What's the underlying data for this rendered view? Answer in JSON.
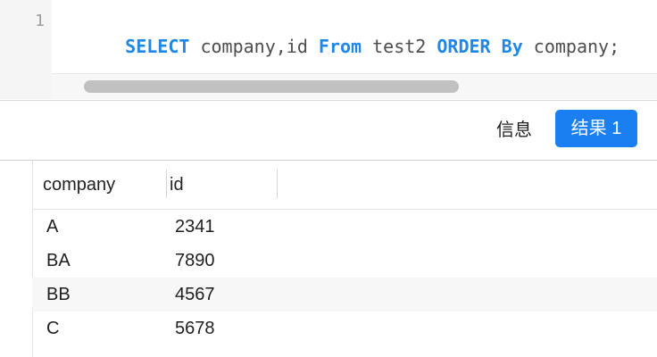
{
  "editor": {
    "line_number": "1",
    "tokens": [
      {
        "text": "SELECT",
        "type": "keyword"
      },
      {
        "text": " company,id ",
        "type": "plain"
      },
      {
        "text": "From",
        "type": "keyword"
      },
      {
        "text": " test2 ",
        "type": "plain"
      },
      {
        "text": "ORDER",
        "type": "keyword"
      },
      {
        "text": " ",
        "type": "plain"
      },
      {
        "text": "By",
        "type": "keyword"
      },
      {
        "text": " company;",
        "type": "plain"
      }
    ],
    "keyword_color": "#1f87e8"
  },
  "tabs": {
    "info_label": "信息",
    "result_label": "结果 1",
    "active_color": "#1a7ff0"
  },
  "table": {
    "columns": [
      "company",
      "id"
    ],
    "rows": [
      {
        "company": "A",
        "id": "2341"
      },
      {
        "company": "BA",
        "id": "7890"
      },
      {
        "company": "BB",
        "id": "4567"
      },
      {
        "company": "C",
        "id": "5678"
      }
    ]
  }
}
